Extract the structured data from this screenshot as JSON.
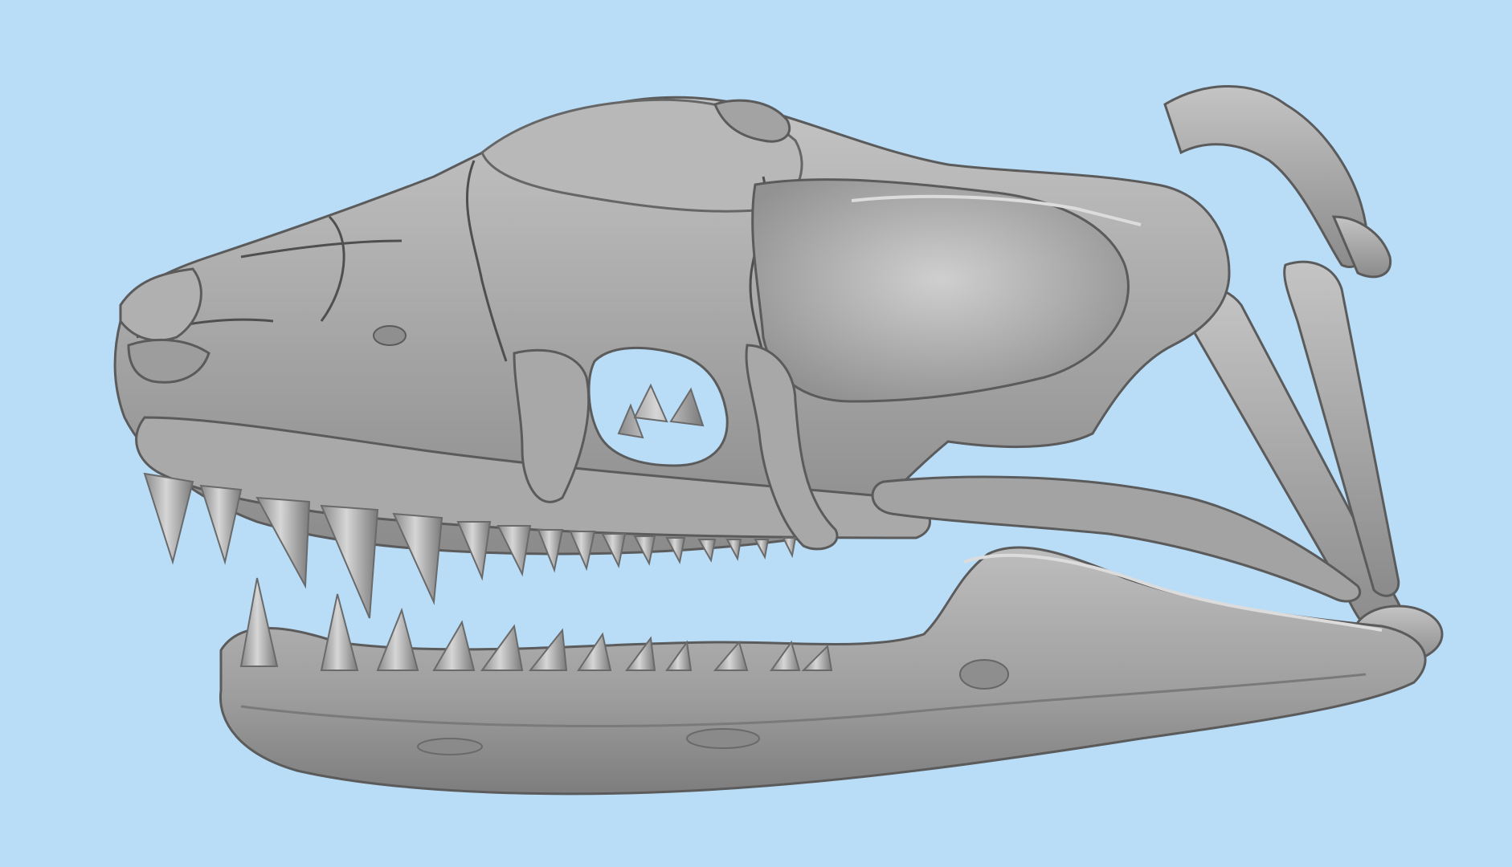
{
  "viewport": {
    "background": "#b9dcf7",
    "model": {
      "subject": "snake-skull",
      "material_color": "#a6a6a6",
      "shade_dark": "#5e5e5e",
      "shade_light": "#d2d2d2",
      "render_style": "flat-shaded mesh"
    }
  }
}
